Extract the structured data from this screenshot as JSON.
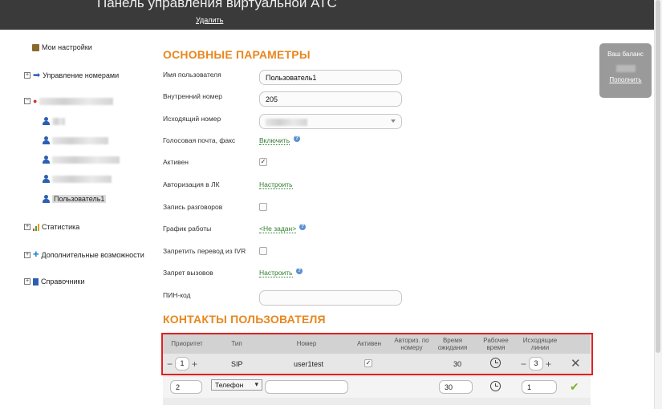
{
  "header": {
    "title": "Панель управления виртуальной АТС",
    "delete_link": "Удалить"
  },
  "sidebar": {
    "my_settings": "Мои настройки",
    "numbers": "Управление номерами",
    "selected_user": "Пользователь1",
    "statistics": "Статистика",
    "extras": "Дополнительные возможности",
    "directories": "Справочники"
  },
  "balance": {
    "label": "Ваш баланс",
    "topup": "Пополнить"
  },
  "main": {
    "section_title": "ОСНОВНЫЕ ПАРАМЕТРЫ",
    "fields": {
      "username_label": "Имя пользователя",
      "username_value": "Пользователь1",
      "extension_label": "Внутренний номер",
      "extension_value": "205",
      "outgoing_label": "Исходящий номер",
      "voicemail_label": "Голосовая почта, факс",
      "voicemail_link": "Включить",
      "active_label": "Активен",
      "auth_label": "Авторизация в ЛК",
      "auth_link": "Настроить",
      "record_label": "Запись разговоров",
      "schedule_label": "График работы",
      "schedule_link": "<Не задан>",
      "ivr_label": "Запретить перевод из IVR",
      "ban_label": "Запрет вызовов",
      "ban_link": "Настроить",
      "pin_label": "ПИН-код"
    },
    "checkboxes": {
      "active": true,
      "record": false,
      "ivr": false
    }
  },
  "contacts": {
    "section_title": "КОНТАКТЫ ПОЛЬЗОВАТЕЛЯ",
    "columns": {
      "priority": "Приоритет",
      "type": "Тип",
      "number": "Номер",
      "active": "Активен",
      "auth": "Авториз. по номеру",
      "wait": "Время ожидания",
      "work": "Рабочее время",
      "lines": "Исходящие линии"
    },
    "row": {
      "priority": "1",
      "type": "SIP",
      "number": "user1test",
      "active": true,
      "wait": "30",
      "lines": "3"
    },
    "new_row": {
      "priority": "2",
      "type": "Телефон",
      "wait": "30",
      "lines": "1"
    }
  },
  "colors": {
    "accent": "#e8871e",
    "link": "#2e7d2e",
    "header_bg": "#3a3a3a",
    "highlight": "#e02020"
  }
}
